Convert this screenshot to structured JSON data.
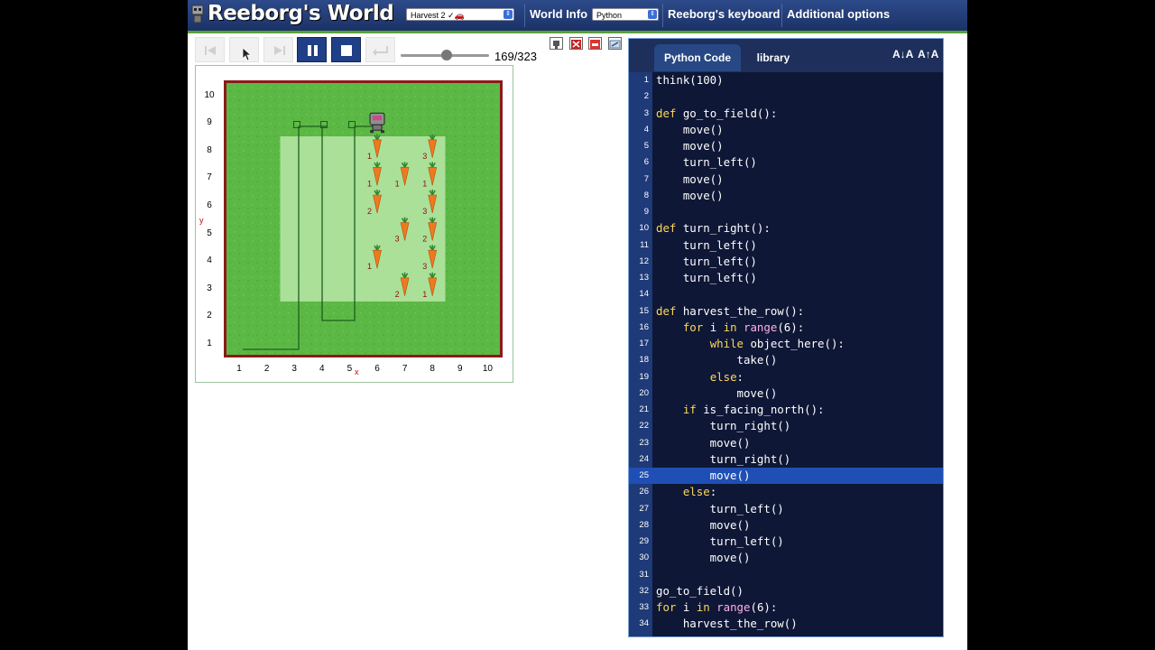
{
  "app": {
    "title": "Reeborg's World",
    "world_select": "Harvest 2 ✓🚗",
    "world_info_label": "World Info",
    "language_select": "Python",
    "keyboard_label": "Reeborg's keyboard",
    "options_label": "Additional options"
  },
  "controls": {
    "step_current": 169,
    "step_total": 323,
    "step_counter": "169/323",
    "speed_fraction": 0.52
  },
  "world": {
    "y_ticks": [
      "10",
      "9",
      "8",
      "7",
      "6",
      "5",
      "4",
      "3",
      "2",
      "1"
    ],
    "x_ticks": [
      "1",
      "2",
      "3",
      "4",
      "5",
      "6",
      "7",
      "8",
      "9",
      "10"
    ],
    "x_axis_letter": "x",
    "y_axis_letter": "y",
    "robot": {
      "x": 6,
      "y": 9
    },
    "carrots": [
      {
        "x": 6,
        "y": 8,
        "n": "1"
      },
      {
        "x": 8,
        "y": 8,
        "n": "3"
      },
      {
        "x": 6,
        "y": 7,
        "n": "1"
      },
      {
        "x": 7,
        "y": 7,
        "n": "1"
      },
      {
        "x": 8,
        "y": 7,
        "n": "1"
      },
      {
        "x": 6,
        "y": 6,
        "n": "2"
      },
      {
        "x": 8,
        "y": 6,
        "n": "3"
      },
      {
        "x": 7,
        "y": 5,
        "n": "3"
      },
      {
        "x": 8,
        "y": 5,
        "n": "2"
      },
      {
        "x": 6,
        "y": 4,
        "n": "1"
      },
      {
        "x": 8,
        "y": 4,
        "n": "3"
      },
      {
        "x": 7,
        "y": 3,
        "n": "2"
      },
      {
        "x": 8,
        "y": 3,
        "n": "1"
      }
    ]
  },
  "editor": {
    "tab_code": "Python Code",
    "tab_library": "library",
    "font_decrease": "A↓A",
    "font_increase": "A↑A",
    "highlight_line": 25,
    "lines": [
      "think(100)",
      "",
      "def go_to_field():",
      "    move()",
      "    move()",
      "    turn_left()",
      "    move()",
      "    move()",
      "",
      "def turn_right():",
      "    turn_left()",
      "    turn_left()",
      "    turn_left()",
      "",
      "def harvest_the_row():",
      "    for i in range(6):",
      "        while object_here():",
      "            take()",
      "        else:",
      "            move()",
      "    if is_facing_north():",
      "        turn_right()",
      "        move()",
      "        turn_right()",
      "        move()",
      "    else:",
      "        turn_left()",
      "        move()",
      "        turn_left()",
      "        move()",
      "",
      "go_to_field()",
      "for i in range(6):",
      "    harvest_the_row()"
    ]
  },
  "colors": {
    "topbar": "#1b3266",
    "grass": "#5cb845",
    "border": "#8b1a1a",
    "field": "#b8e6a8",
    "editor_bg": "#0e1736",
    "highlight": "#1f4fb4"
  }
}
